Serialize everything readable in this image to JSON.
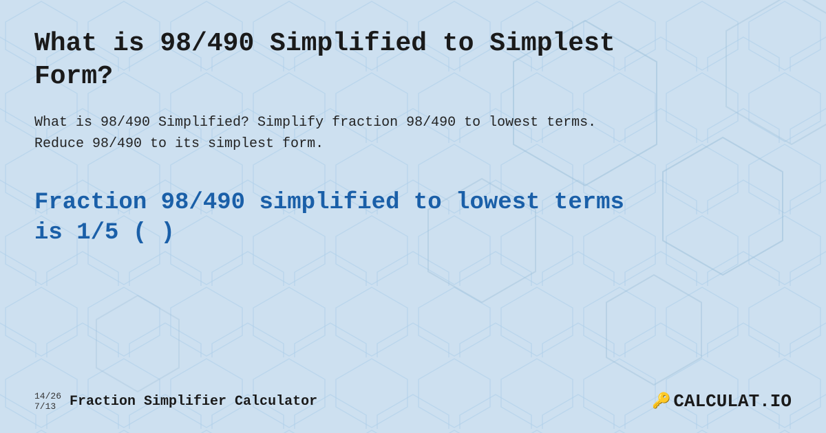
{
  "background": {
    "color": "#c8dff5"
  },
  "title": "What is 98/490 Simplified to Simplest Form?",
  "description": "What is 98/490 Simplified? Simplify fraction 98/490 to lowest terms. Reduce 98/490 to its simplest form.",
  "result": {
    "text": "Fraction 98/490 simplified to lowest terms is 1/5 ( )"
  },
  "footer": {
    "fraction_top": "14/26",
    "fraction_bottom": "7/13",
    "brand_label": "Fraction Simplifier Calculator",
    "logo_text": "CALCULAT.IO"
  }
}
